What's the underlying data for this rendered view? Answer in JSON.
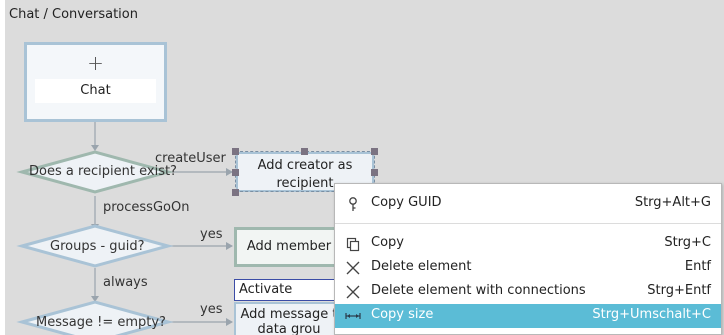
{
  "title": "Chat / Conversation",
  "nodes": {
    "start_plus": "+",
    "start": "Chat",
    "decision1": "Does a recipient exist?",
    "decision2": "Groups - guid?",
    "decision3": "Message != empty?",
    "box1": "Add creator as recipient",
    "box2": "Add member",
    "box3": "Activate Subsec",
    "box4": "Add message t data grou"
  },
  "edges": {
    "create_user": "createUser",
    "process_go_on": "processGoOn",
    "yes1": "yes",
    "always": "always",
    "yes2": "yes"
  },
  "menu": {
    "items": [
      {
        "label": "Copy GUID",
        "shortcut": "Strg+Alt+G",
        "icon": "key-icon"
      },
      {
        "label": "Copy",
        "shortcut": "Strg+C",
        "icon": "copy-icon"
      },
      {
        "label": "Delete element",
        "shortcut": "Entf",
        "icon": "close-icon"
      },
      {
        "label": "Delete element with connections",
        "shortcut": "Strg+Entf",
        "icon": "close-icon"
      },
      {
        "label": "Copy size",
        "shortcut": "Strg+Umschalt+C",
        "icon": "size-arrows-icon"
      }
    ],
    "highlight_color": "#5bbcd6"
  }
}
